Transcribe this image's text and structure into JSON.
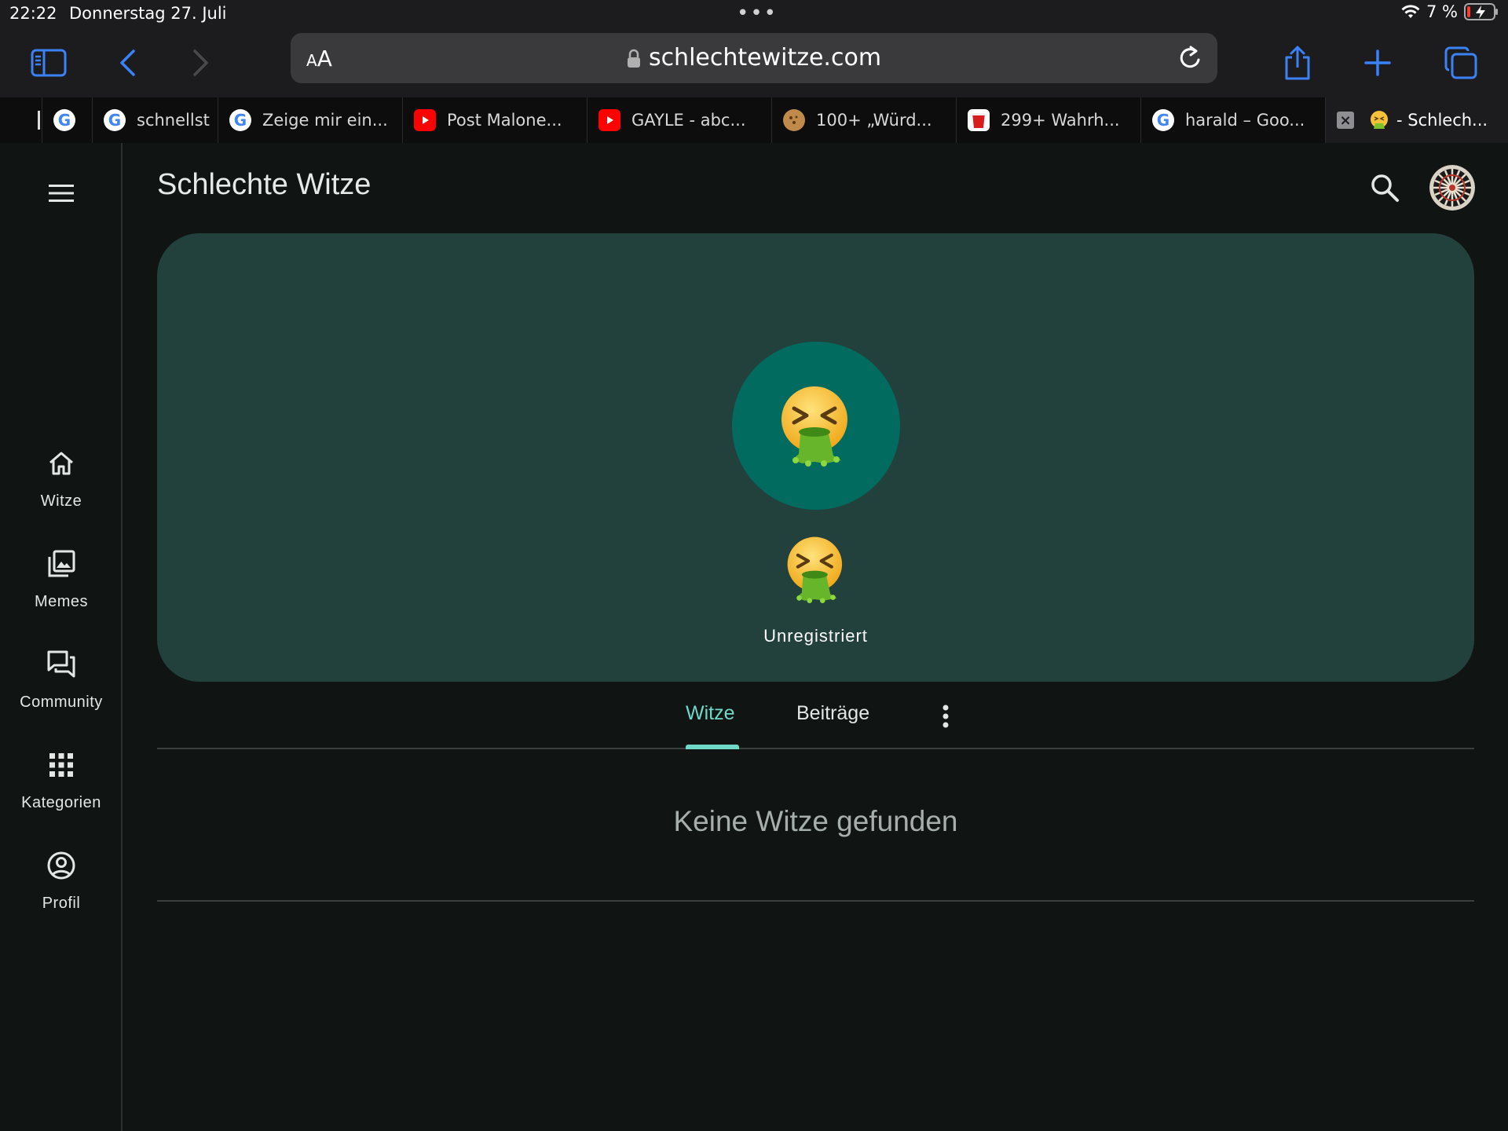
{
  "status": {
    "time": "22:22",
    "date": "Donnerstag 27. Juli",
    "battery": "7 %"
  },
  "browser": {
    "aa_small": "A",
    "aa_big": "A",
    "url": "schlechtewitze.com",
    "tabs": [
      {
        "title": ""
      },
      {
        "title": ""
      },
      {
        "title": "schnellst"
      },
      {
        "title": "Zeige mir ein..."
      },
      {
        "title": "Post Malone..."
      },
      {
        "title": "GAYLE - abc..."
      },
      {
        "title": "100+ „Würd..."
      },
      {
        "title": "299+ Wahrh..."
      },
      {
        "title": "harald – Goo..."
      },
      {
        "title": "- Schlech..."
      }
    ]
  },
  "app": {
    "title": "Schlechte Witze",
    "nav": [
      {
        "label": "Witze",
        "icon": "home-icon"
      },
      {
        "label": "Memes",
        "icon": "image-library-icon"
      },
      {
        "label": "Community",
        "icon": "forum-icon"
      },
      {
        "label": "Kategorien",
        "icon": "grid-icon"
      },
      {
        "label": "Profil",
        "icon": "account-circle-icon"
      }
    ],
    "profile": {
      "username": "Unregistriert",
      "avatar_emoji": "vomiting-face"
    },
    "profile_tabs": [
      {
        "label": "Witze",
        "active": true
      },
      {
        "label": "Beiträge",
        "active": false
      }
    ],
    "empty_message": "Keine Witze gefunden"
  },
  "colors": {
    "accent": "#6fd8c6",
    "banner": "#22413d",
    "avatar_bg": "#006b5e",
    "background": "#101514"
  }
}
